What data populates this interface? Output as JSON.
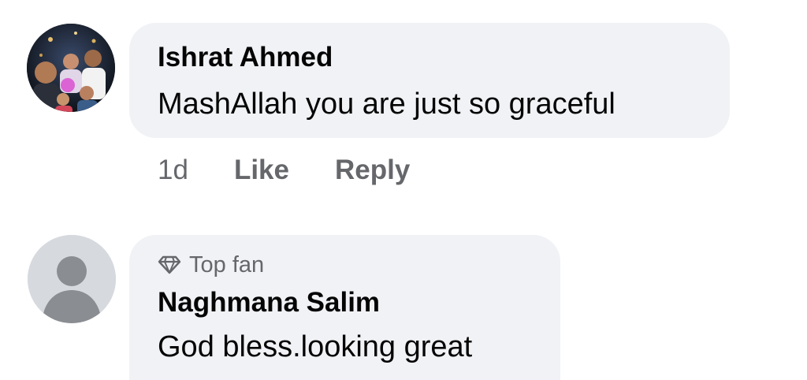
{
  "comments": [
    {
      "author": "Ishrat Ahmed",
      "text": "MashAllah you are just so graceful",
      "time": "1d",
      "like_label": "Like",
      "reply_label": "Reply",
      "avatar_icon": "photo-avatar"
    },
    {
      "badge": "Top fan",
      "badge_icon": "diamond-icon",
      "author": "Naghmana Salim",
      "text": "God bless.looking great",
      "avatar_icon": "default-person-avatar"
    }
  ],
  "colors": {
    "bubble": "#f0f2f5",
    "secondary_text": "#65676b",
    "primary_text": "#050505",
    "default_avatar_bg": "#d6d9de",
    "default_avatar_fg": "#8a8d91"
  }
}
